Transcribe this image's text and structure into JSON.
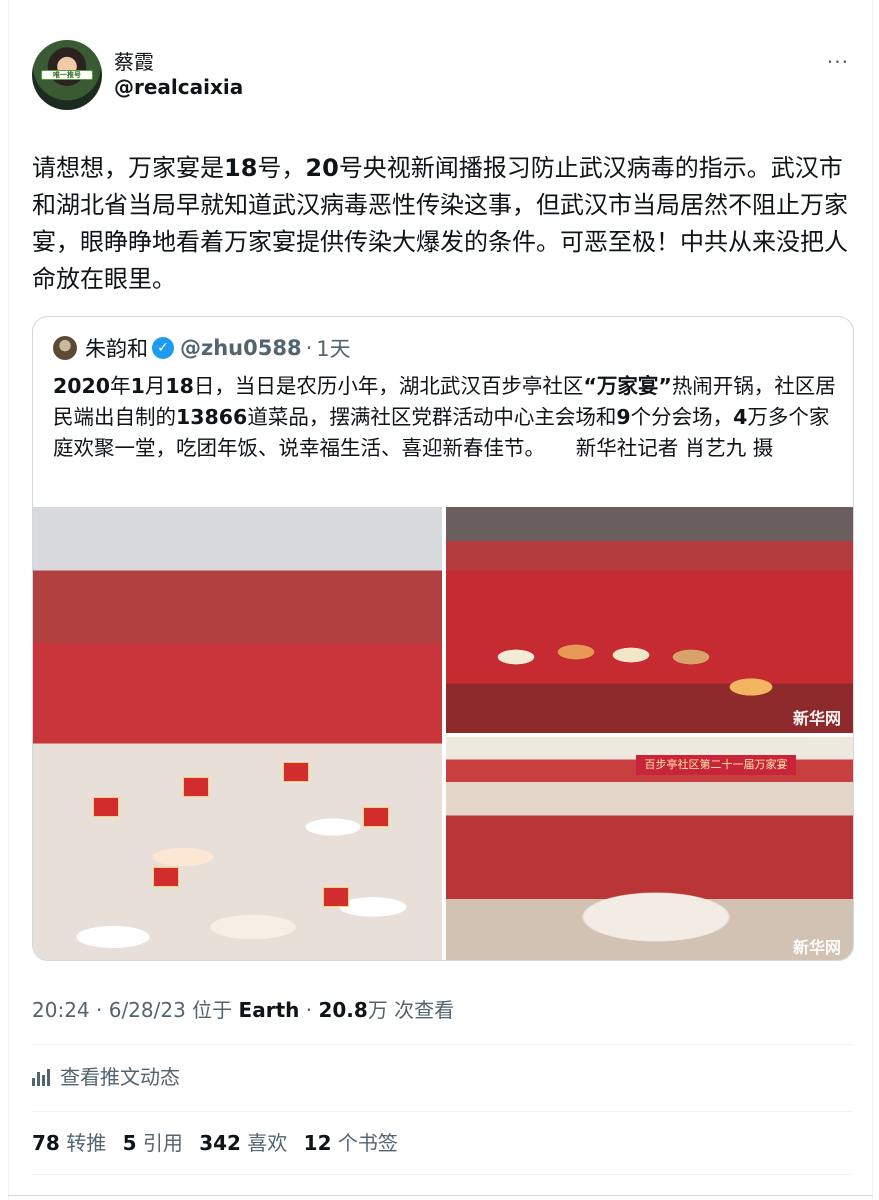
{
  "author": {
    "display_name": "蔡霞",
    "handle": "@realcaixia",
    "avatar_badge": "唯一推号"
  },
  "more_label": "···",
  "tweet_text": [
    {
      "t": "请想想，万家宴是",
      "b": false
    },
    {
      "t": "18",
      "b": true
    },
    {
      "t": "号，",
      "b": false
    },
    {
      "t": "20",
      "b": true
    },
    {
      "t": "号央视新闻播报习防止武汉病毒的指示。武汉市和湖北省当局早就知道武汉病毒恶性传染这事，但武汉市当局居然不阻止万家宴，眼睁睁地看着万家宴提供传染大爆发的条件。可恶至极！中共从来没把人命放在眼里。",
      "b": false
    }
  ],
  "quoted": {
    "display_name": "朱韵和",
    "verified_glyph": "✓",
    "handle": "@zhu0588",
    "dot": "·",
    "time": "1天",
    "text": [
      {
        "t": "2020",
        "b": true
      },
      {
        "t": "年",
        "b": false
      },
      {
        "t": "1",
        "b": true
      },
      {
        "t": "月",
        "b": false
      },
      {
        "t": "18",
        "b": true
      },
      {
        "t": "日，当日是农历小年，湖北武汉百步亭社区",
        "b": false
      },
      {
        "t": "“万家宴”",
        "b": true
      },
      {
        "t": "热闹开锅，社区居民端出自制的",
        "b": false
      },
      {
        "t": "13866",
        "b": true
      },
      {
        "t": "道菜品，摆满社区党群活动中心主会场和",
        "b": false
      },
      {
        "t": "9",
        "b": true
      },
      {
        "t": "个分会场，",
        "b": false
      },
      {
        "t": "4",
        "b": true
      },
      {
        "t": "万多个家庭欢聚一堂，吃团年饭、说幸福生活、喜迎新春佳节。　　新华社记者 肖艺九 摄",
        "b": false
      }
    ],
    "photos": {
      "watermark": "新华网",
      "banner": "百步亭社区第二十一届万家宴"
    }
  },
  "meta": {
    "time": "20:24",
    "dot1": " · ",
    "date": "6/28/23",
    "location_prefix": " 位于 ",
    "location": "Earth",
    "dot2": " · ",
    "views": "20.8",
    "views_suffix": "万 次查看"
  },
  "analytics_label": "查看推文动态",
  "stats": {
    "retweets": "78",
    "retweets_label": " 转推",
    "quotes": "5",
    "quotes_label": " 引用",
    "likes": "342",
    "likes_label": " 喜欢",
    "bookmarks": "12",
    "bookmarks_label": " 个书签"
  }
}
